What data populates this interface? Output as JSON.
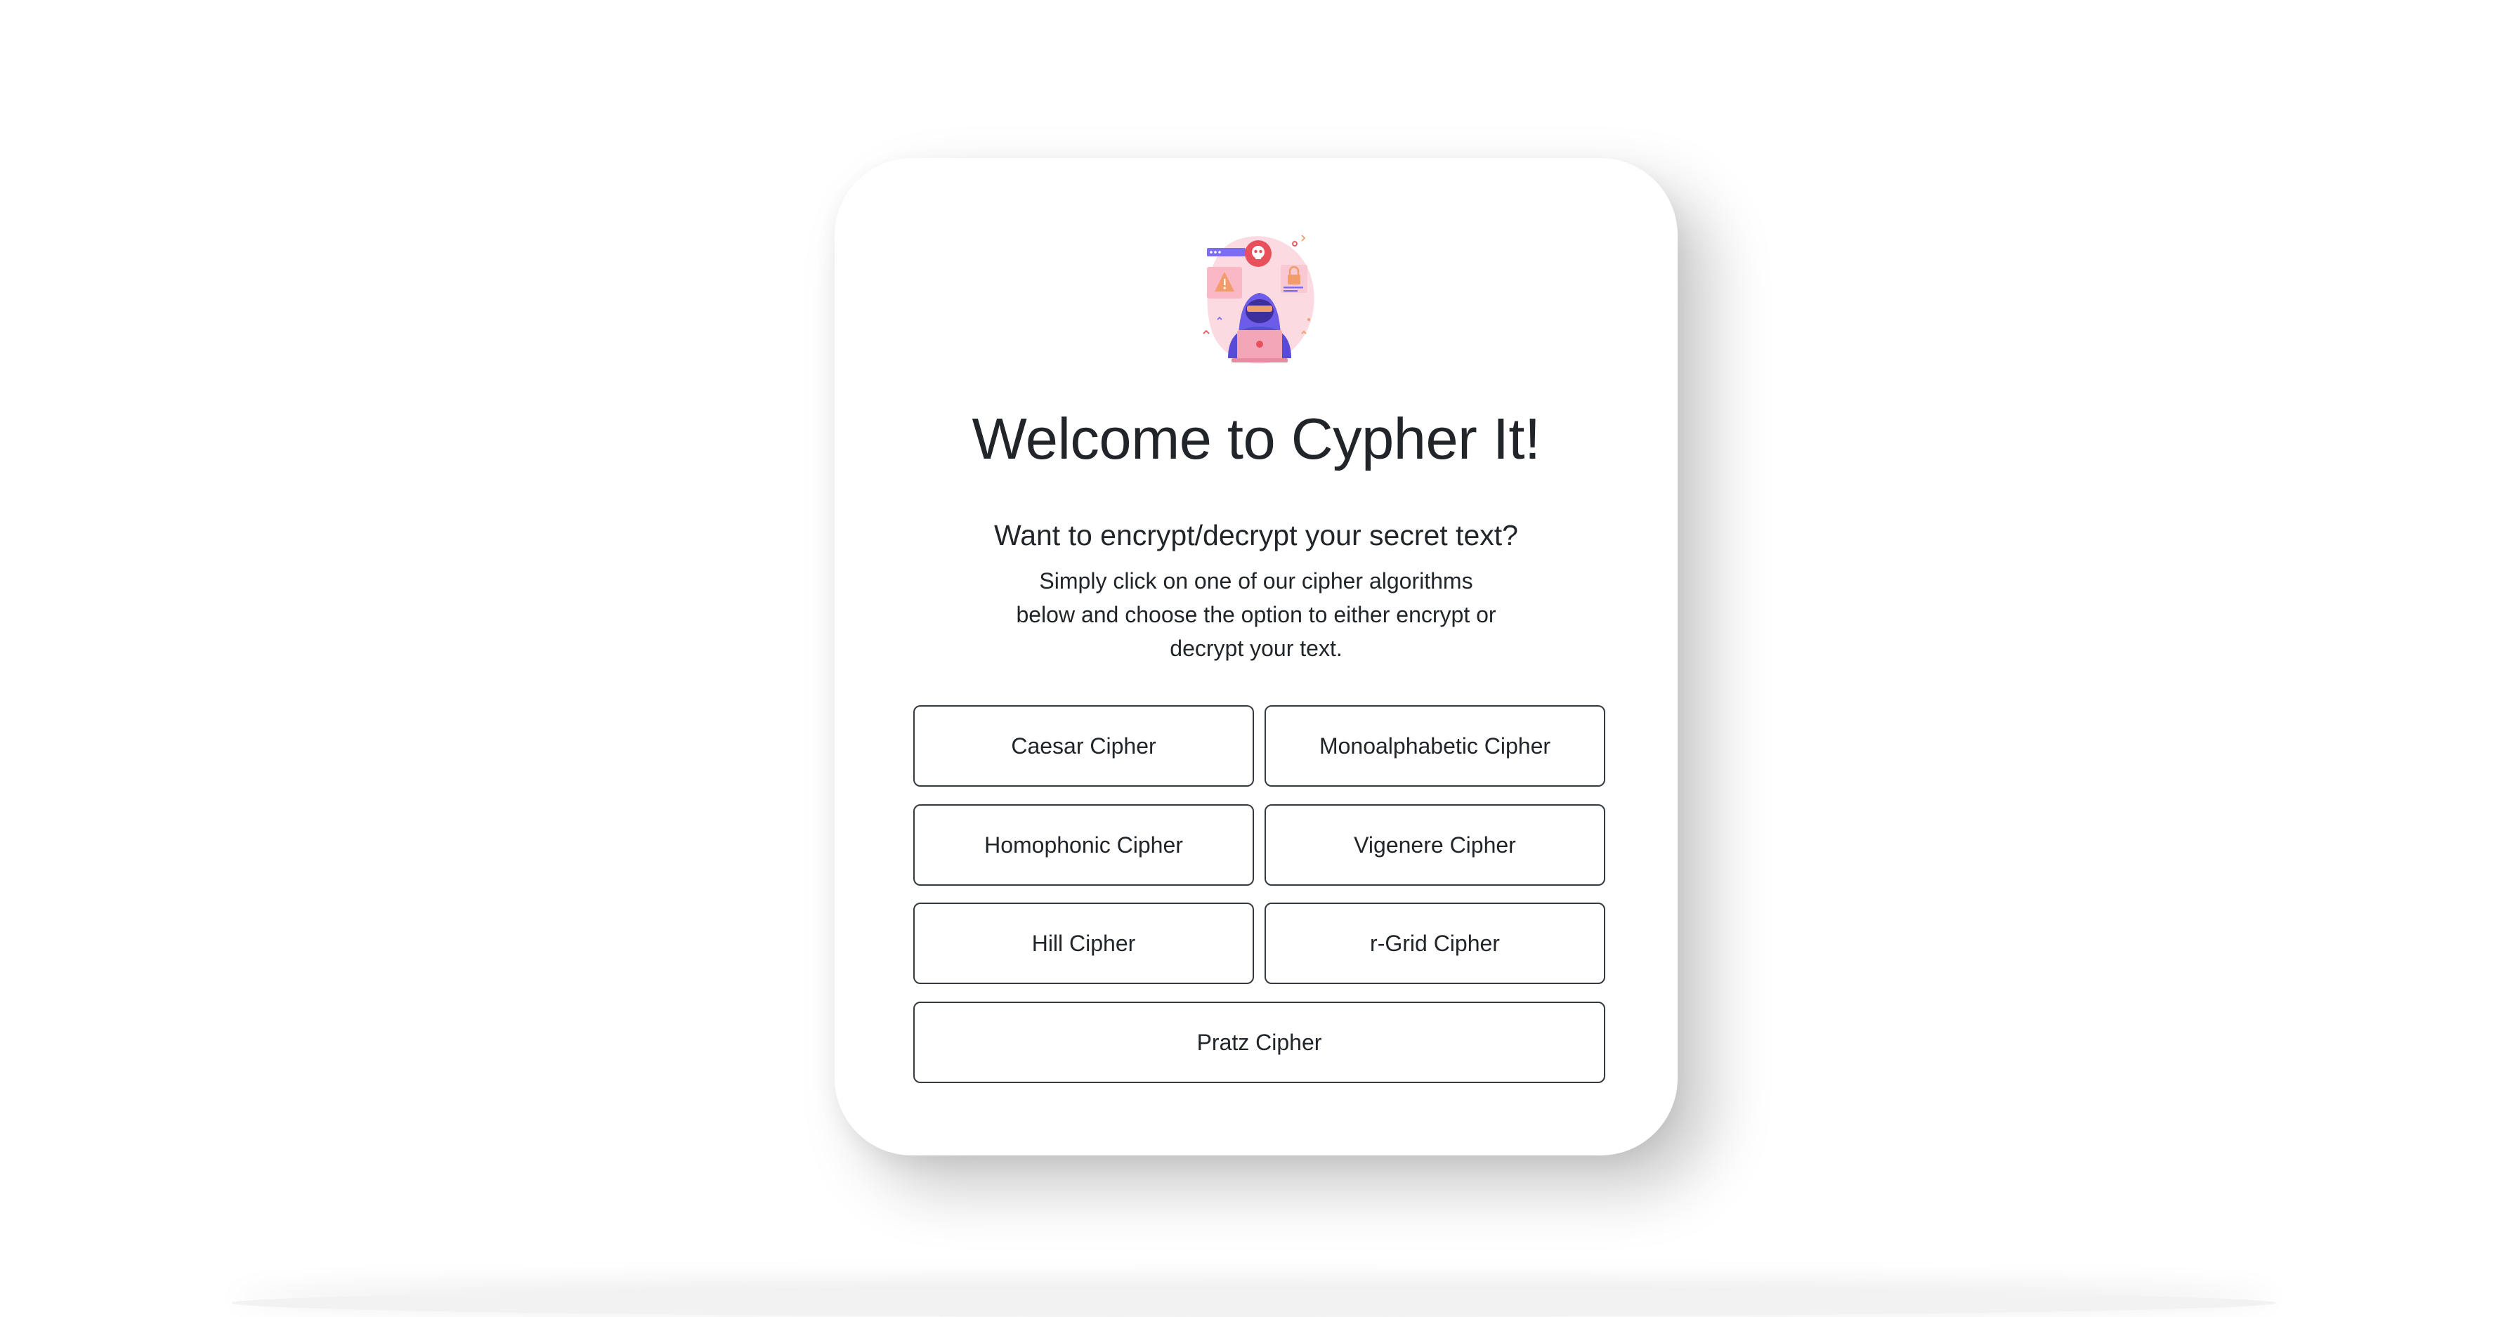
{
  "app": {
    "title": "Welcome to Cypher It!",
    "subtitle": "Want to encrypt/decrypt your secret text?",
    "description": "Simply click on one of our cipher algorithms below and choose the option to either encrypt or decrypt your text.",
    "hero_icon": "hacker-illustration"
  },
  "ciphers": {
    "caesar": "Caesar Cipher",
    "monoalphabetic": "Monoalphabetic Cipher",
    "homophonic": "Homophonic Cipher",
    "vigenere": "Vigenere Cipher",
    "hill": "Hill Cipher",
    "rgrid": "r-Grid Cipher",
    "pratz": "Pratz Cipher"
  },
  "colors": {
    "accent_purple": "#6c5ce7",
    "accent_pink": "#f8a5b5",
    "accent_red": "#e74c3c",
    "button_border": "#343a40",
    "text": "#212529"
  }
}
